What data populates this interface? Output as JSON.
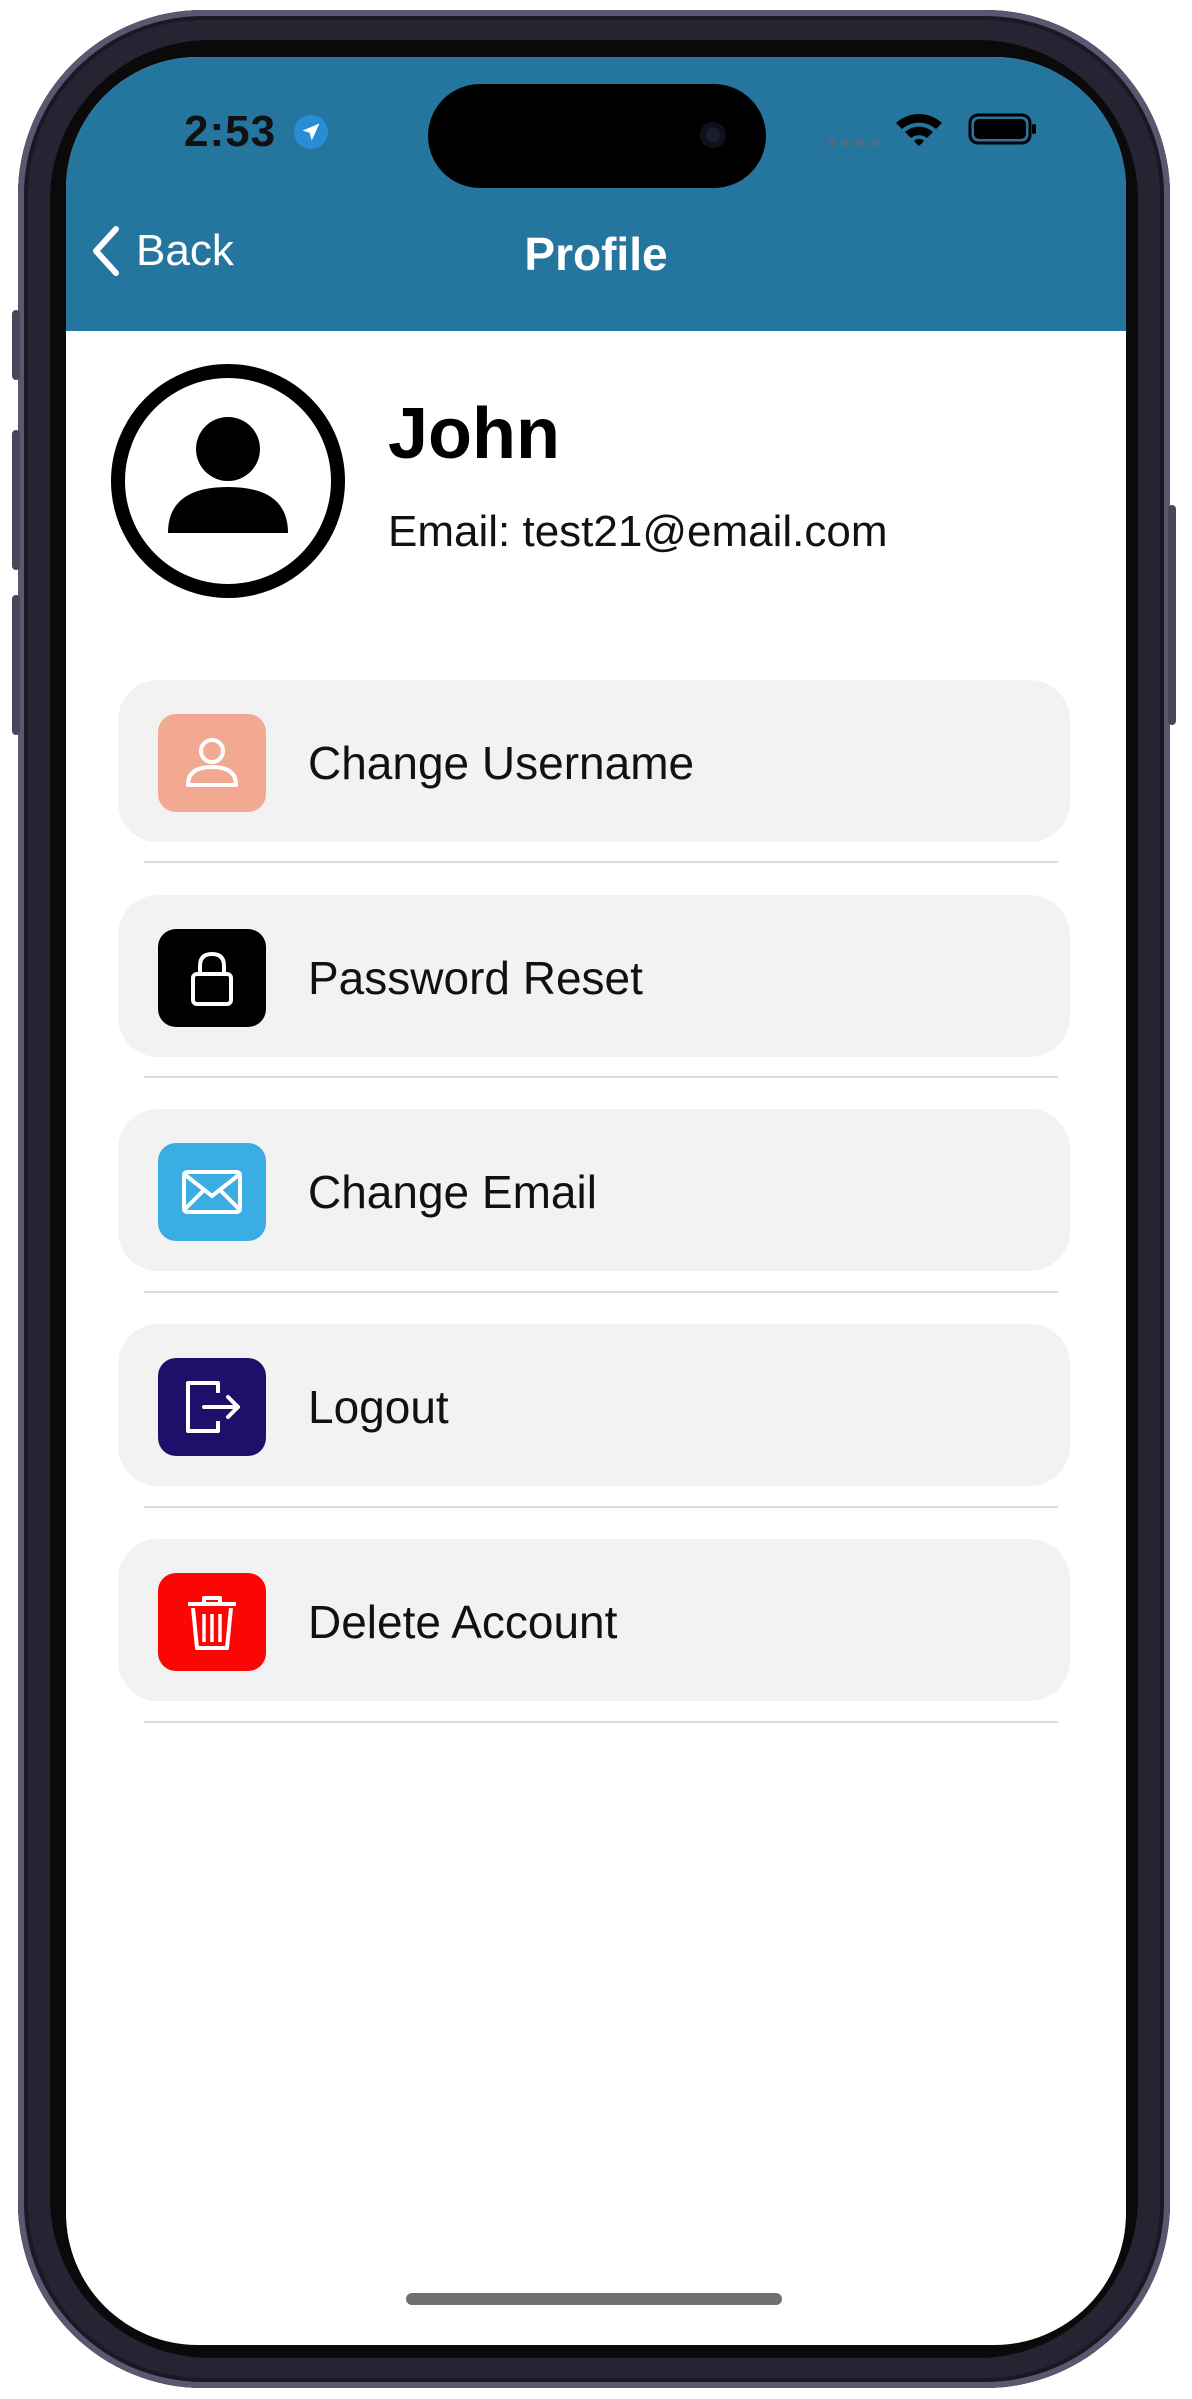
{
  "status_bar": {
    "time": "2:53"
  },
  "nav": {
    "back_label": "Back",
    "title": "Profile"
  },
  "profile": {
    "name": "John",
    "email": "Email: test21@email.com"
  },
  "menu": [
    {
      "label": "Change Username",
      "icon": "person-icon",
      "color": "#f3a891"
    },
    {
      "label": "Password Reset",
      "icon": "lock-icon",
      "color": "#000000"
    },
    {
      "label": "Change Email",
      "icon": "envelope-icon",
      "color": "#3aade3"
    },
    {
      "label": "Logout",
      "icon": "logout-icon",
      "color": "#1e0f6b"
    },
    {
      "label": "Delete Account",
      "icon": "trash-icon",
      "color": "#fc0505"
    }
  ],
  "colors": {
    "header": "#24769f"
  }
}
